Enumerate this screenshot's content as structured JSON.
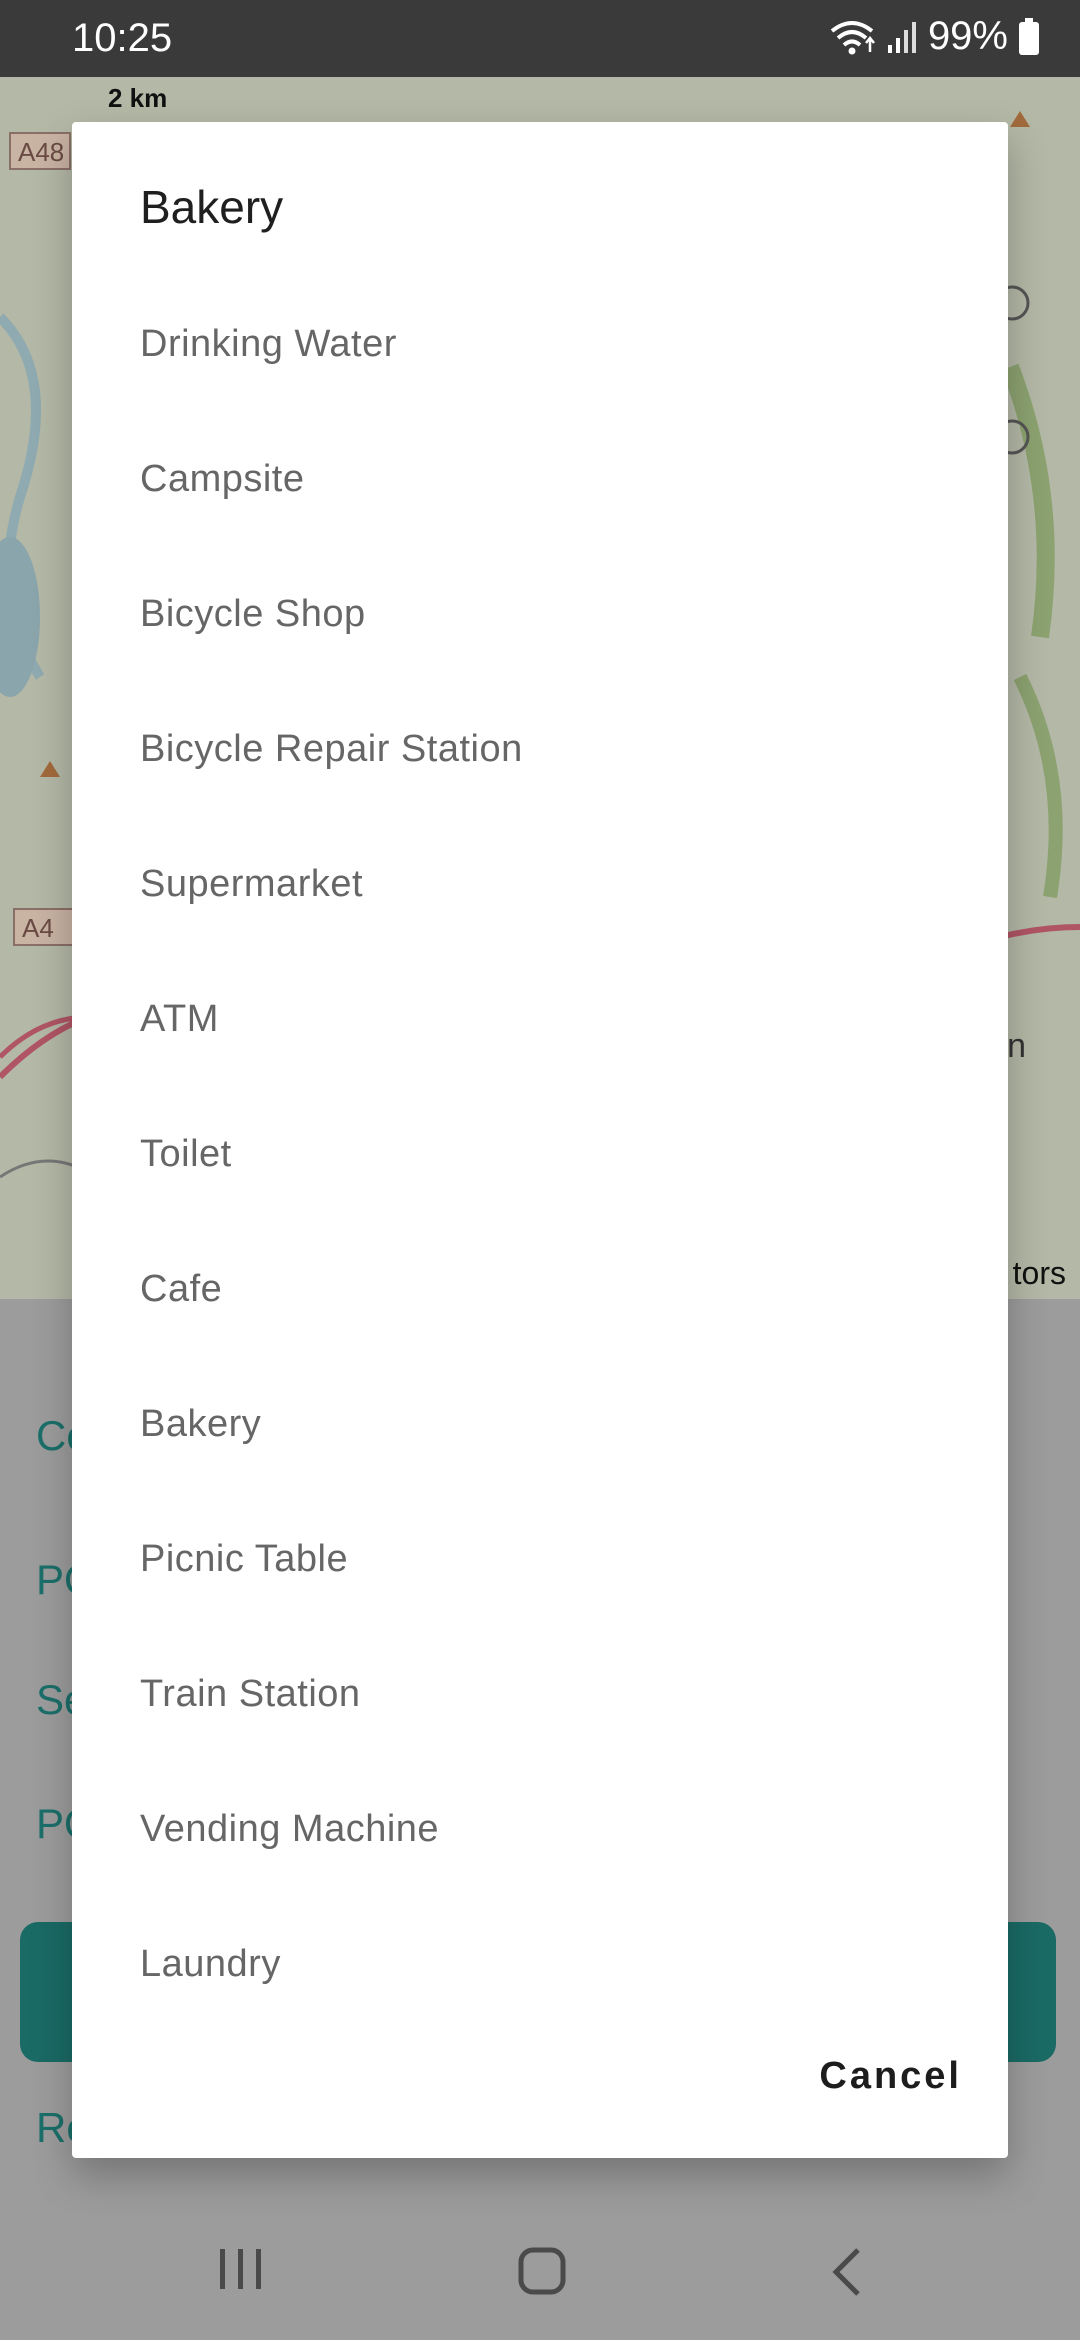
{
  "status_bar": {
    "time": "10:25",
    "battery_percent": "99%",
    "icons": [
      "wifi-icon",
      "signal-icon",
      "battery-icon"
    ]
  },
  "map": {
    "scale_label": "2 km",
    "road_labels": [
      "A48",
      "A4"
    ],
    "poi_label_fragment": "n",
    "attribution_fragment": "tors"
  },
  "background_links": [
    "Co",
    "PO",
    "Se",
    "PO",
    "Ro"
  ],
  "dialog": {
    "title": "Bakery",
    "options": [
      "Drinking Water",
      "Campsite",
      "Bicycle Shop",
      "Bicycle Repair Station",
      "Supermarket",
      "ATM",
      "Toilet",
      "Cafe",
      "Bakery",
      "Picnic Table",
      "Train Station",
      "Vending Machine",
      "Laundry"
    ],
    "cancel_label": "Cancel"
  },
  "nav_bar": {
    "icons": [
      "recent-apps-icon",
      "home-icon",
      "back-icon"
    ]
  },
  "colors": {
    "status_bar_bg": "#3a3a3a",
    "scrim": "#9c9c9c",
    "accent_teal": "#1a6a65",
    "option_text": "#666666",
    "title_text": "#1f1f1f"
  }
}
